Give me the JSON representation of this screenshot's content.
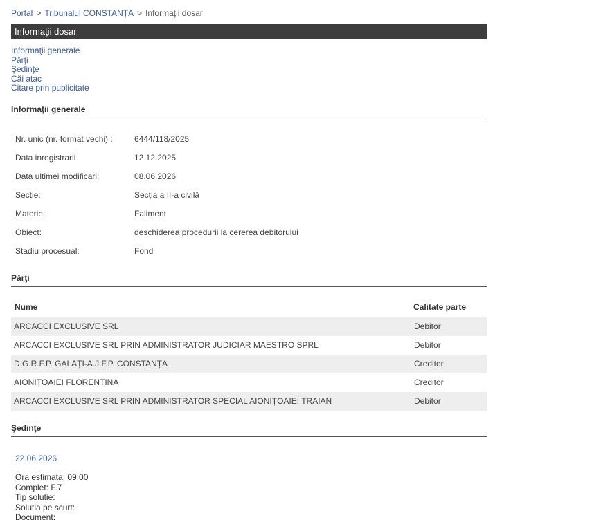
{
  "breadcrumb": {
    "portal": "Portal",
    "court": "Tribunalul CONSTANȚA",
    "current": "Informaţii dosar"
  },
  "title": "Informaţii dosar",
  "nav": {
    "general": "Informaţii generale",
    "parti": "Părţi",
    "sedinte": "Şedinţe",
    "cai_atac": "Căi atac",
    "citare": "Citare prin publicitate"
  },
  "general": {
    "heading": "Informaţii generale",
    "rows": [
      {
        "label": "Nr. unic (nr. format vechi) :",
        "value": "6444/118/2025"
      },
      {
        "label": "Data inregistrarii",
        "value": "12.12.2025"
      },
      {
        "label": "Data ultimei modificari:",
        "value": "08.06.2026"
      },
      {
        "label": "Sectie:",
        "value": "Secția a II-a civilă"
      },
      {
        "label": "Materie:",
        "value": "Faliment"
      },
      {
        "label": "Obiect:",
        "value": "deschiderea procedurii la cererea debitorului"
      },
      {
        "label": "Stadiu procesual:",
        "value": "Fond"
      }
    ]
  },
  "parti": {
    "heading": "Părţi",
    "col_nume": "Nume",
    "col_calitate": "Calitate parte",
    "rows": [
      {
        "nume": "ARCACCI EXCLUSIVE SRL",
        "calitate": "Debitor"
      },
      {
        "nume": "ARCACCI EXCLUSIVE SRL PRIN ADMINISTRATOR JUDICIAR MAESTRO SPRL",
        "calitate": "Debitor"
      },
      {
        "nume": "D.G.R.F.P. GALAȚI-A.J.F.P. CONSTANȚA",
        "calitate": "Creditor"
      },
      {
        "nume": "AIONIȚOAIEI FLORENTINA",
        "calitate": "Creditor"
      },
      {
        "nume": "ARCACCI EXCLUSIVE SRL PRIN ADMINISTRATOR SPECIAL AIONIȚOAIEI TRAIAN",
        "calitate": "Debitor"
      }
    ]
  },
  "sedinte": {
    "heading": "Şedinţe",
    "date": "22.06.2026",
    "ora": "Ora estimata: 09:00",
    "complet": "Complet: F.7",
    "tip_solutie": "Tip solutie:",
    "solutia": "Solutia pe scurt:",
    "document": "Document:"
  }
}
